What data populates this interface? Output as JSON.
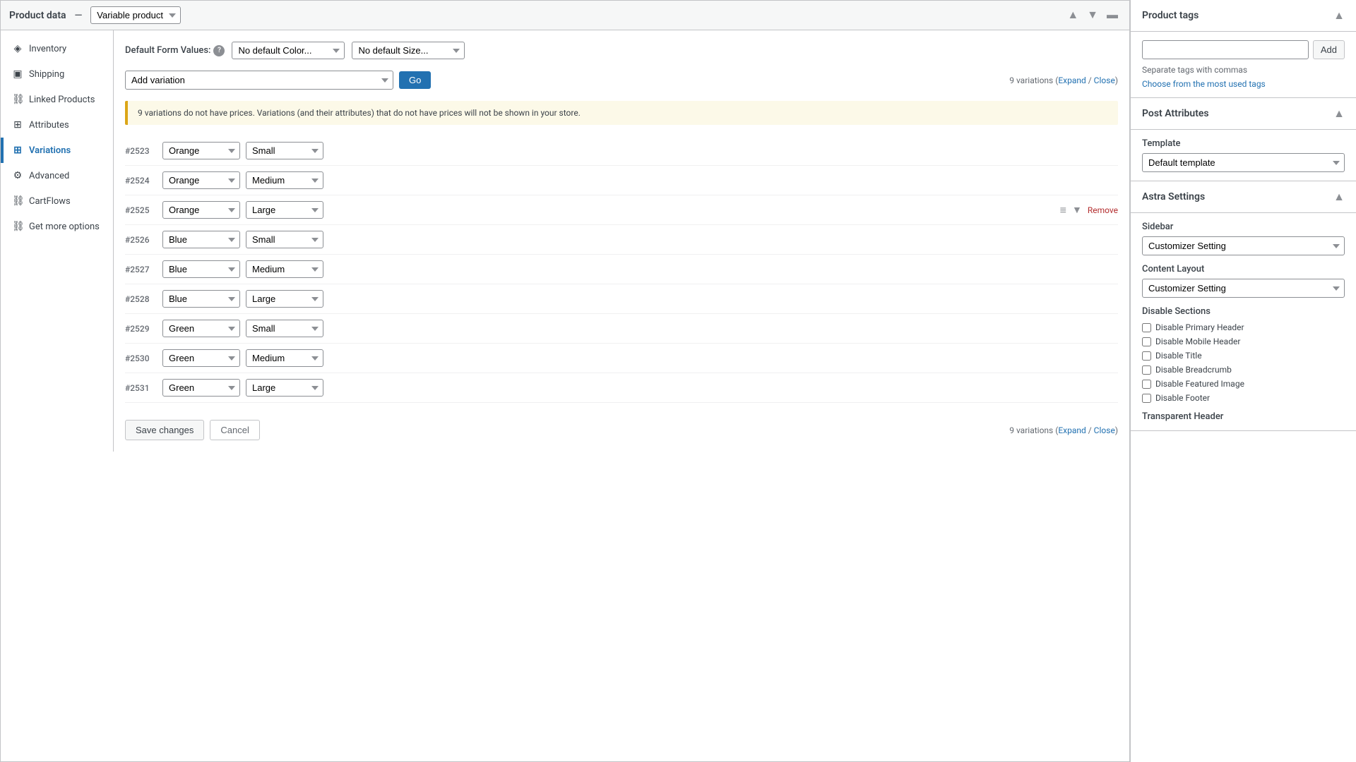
{
  "header": {
    "title": "Product data",
    "separator": "—",
    "product_type": "Variable product",
    "collapse_icon": "▲",
    "expand_icon": "▼",
    "minimize_icon": "▬"
  },
  "sidebar_nav": {
    "items": [
      {
        "id": "inventory",
        "label": "Inventory",
        "icon": "◈",
        "active": false
      },
      {
        "id": "shipping",
        "label": "Shipping",
        "icon": "▣",
        "active": false
      },
      {
        "id": "linked-products",
        "label": "Linked Products",
        "icon": "⛓",
        "active": false
      },
      {
        "id": "attributes",
        "label": "Attributes",
        "icon": "⊞",
        "active": false
      },
      {
        "id": "variations",
        "label": "Variations",
        "icon": "⊞",
        "active": true
      },
      {
        "id": "advanced",
        "label": "Advanced",
        "icon": "⚙",
        "active": false
      },
      {
        "id": "cartflows",
        "label": "CartFlows",
        "icon": "⛓",
        "active": false
      },
      {
        "id": "get-more-options",
        "label": "Get more options",
        "icon": "⛓",
        "active": false
      }
    ]
  },
  "content": {
    "default_form_values_label": "Default Form Values:",
    "help_icon": "?",
    "color_dropdown": {
      "value": "No default Color...",
      "options": [
        "No default Color...",
        "Orange",
        "Blue",
        "Green"
      ]
    },
    "size_dropdown": {
      "value": "No default Size...",
      "options": [
        "No default Size...",
        "Small",
        "Medium",
        "Large"
      ]
    },
    "add_variation_label": "Add variation",
    "go_btn_label": "Go",
    "variations_count": "9 variations",
    "expand_link": "Expand",
    "close_link": "Close",
    "warning_message": "9 variations do not have prices. Variations (and their attributes) that do not have prices will not be shown in your store.",
    "variations": [
      {
        "id": "#2523",
        "color": "Orange",
        "size": "Small"
      },
      {
        "id": "#2524",
        "color": "Orange",
        "size": "Medium"
      },
      {
        "id": "#2525",
        "color": "Orange",
        "size": "Large",
        "show_actions": true
      },
      {
        "id": "#2526",
        "color": "Blue",
        "size": "Small"
      },
      {
        "id": "#2527",
        "color": "Blue",
        "size": "Medium"
      },
      {
        "id": "#2528",
        "color": "Blue",
        "size": "Large"
      },
      {
        "id": "#2529",
        "color": "Green",
        "size": "Small"
      },
      {
        "id": "#2530",
        "color": "Green",
        "size": "Medium"
      },
      {
        "id": "#2531",
        "color": "Green",
        "size": "Large"
      }
    ],
    "color_options": [
      "Orange",
      "Blue",
      "Green"
    ],
    "size_options": [
      "Small",
      "Medium",
      "Large"
    ],
    "bottom_variations_count": "9 variations",
    "bottom_expand_link": "Expand",
    "bottom_close_link": "Close",
    "save_changes_label": "Save changes",
    "cancel_label": "Cancel",
    "remove_label": "Remove"
  },
  "right_panel": {
    "product_tags": {
      "section_title": "Product tags",
      "input_placeholder": "",
      "add_btn_label": "Add",
      "hint": "Separate tags with commas",
      "choose_link": "Choose from the most used tags"
    },
    "post_attributes": {
      "section_title": "Post Attributes",
      "template_label": "Template",
      "template_value": "Default template",
      "template_options": [
        "Default template"
      ]
    },
    "astra_settings": {
      "section_title": "Astra Settings",
      "sidebar_label": "Sidebar",
      "sidebar_value": "Customizer Setting",
      "sidebar_options": [
        "Customizer Setting"
      ],
      "content_layout_label": "Content Layout",
      "content_layout_value": "Customizer Setting",
      "content_layout_options": [
        "Customizer Setting"
      ],
      "disable_sections_label": "Disable Sections",
      "checkboxes": [
        {
          "id": "disable-primary-header",
          "label": "Disable Primary Header",
          "checked": false
        },
        {
          "id": "disable-mobile-header",
          "label": "Disable Mobile Header",
          "checked": false
        },
        {
          "id": "disable-title",
          "label": "Disable Title",
          "checked": false
        },
        {
          "id": "disable-breadcrumb",
          "label": "Disable Breadcrumb",
          "checked": false
        },
        {
          "id": "disable-featured-image",
          "label": "Disable Featured Image",
          "checked": false
        },
        {
          "id": "disable-footer",
          "label": "Disable Footer",
          "checked": false
        }
      ],
      "transparent_header_label": "Transparent Header"
    }
  }
}
